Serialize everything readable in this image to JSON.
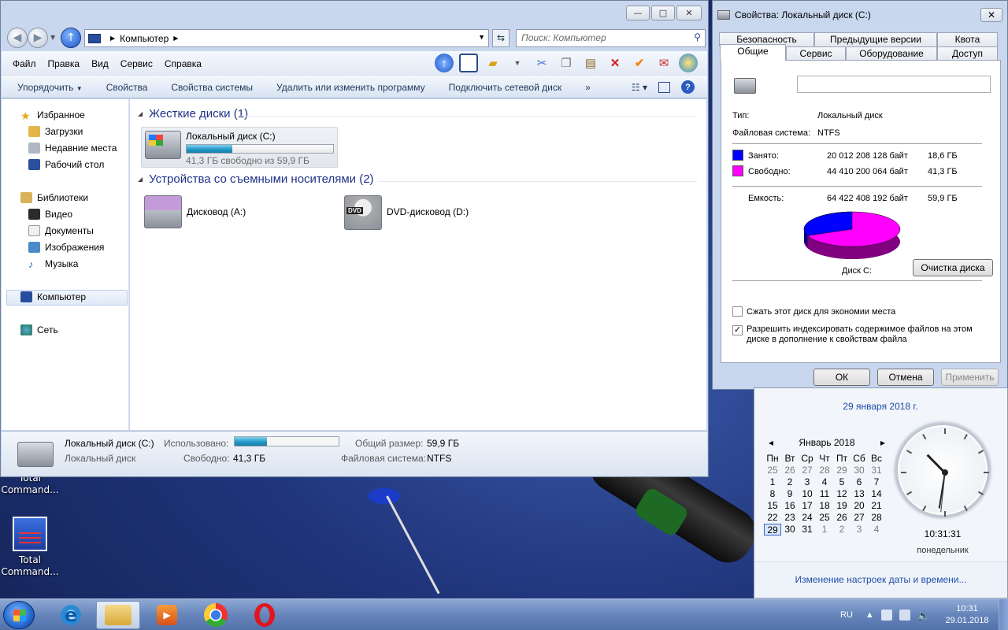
{
  "explorer": {
    "address": {
      "location": "Компьютер"
    },
    "search": {
      "placeholder": "Поиск: Компьютер"
    },
    "menu": [
      "Файл",
      "Правка",
      "Вид",
      "Сервис",
      "Справка"
    ],
    "toolbar_icons": [
      "up-folder-icon",
      "preview-pane-icon",
      "folder-icon",
      "cut-icon",
      "copy-icon",
      "paste-icon",
      "delete-icon",
      "check-icon",
      "mail-icon",
      "network-icon"
    ],
    "commands": [
      "Упорядочить",
      "Свойства",
      "Свойства системы",
      "Удалить или изменить программу",
      "Подключить сетевой диск"
    ],
    "more": "»",
    "nav": {
      "favorites": "Избранное",
      "downloads": "Загрузки",
      "recent": "Недавние места",
      "desktop": "Рабочий стол",
      "libraries": "Библиотеки",
      "video": "Видео",
      "documents": "Документы",
      "images": "Изображения",
      "music": "Музыка",
      "computer": "Компьютер",
      "network": "Сеть"
    },
    "groups": {
      "hard_disks": "Жесткие диски (1)",
      "removable": "Устройства со съемными носителями (2)"
    },
    "drives": {
      "c": {
        "name": "Локальный диск (C:)",
        "free_text": "41,3 ГБ свободно из 59,9 ГБ",
        "used_fraction": 0.31
      },
      "a": {
        "name": "Дисковод (A:)"
      },
      "d": {
        "name": "DVD-дисковод (D:)",
        "badge": "DVD"
      }
    },
    "status": {
      "name": "Локальный диск (C:)",
      "type": "Локальный диск",
      "used_label": "Использовано:",
      "free_label": "Свободно:",
      "free_value": "41,3 ГБ",
      "total_label": "Общий размер:",
      "total_value": "59,9 ГБ",
      "fs_label": "Файловая система:",
      "fs_value": "NTFS"
    }
  },
  "props": {
    "title": "Свойства: Локальный диск (C:)",
    "tabs_row1": [
      "Безопасность",
      "Предыдущие версии",
      "Квота"
    ],
    "tabs_row2": [
      "Общие",
      "Сервис",
      "Оборудование",
      "Доступ"
    ],
    "type_label": "Тип:",
    "type_value": "Локальный диск",
    "fs_label": "Файловая система:",
    "fs_value": "NTFS",
    "used_label": "Занято:",
    "used_bytes": "20 012 208 128 байт",
    "used_gb": "18,6 ГБ",
    "free_label": "Свободно:",
    "free_bytes": "44 410 200 064 байт",
    "free_gb": "41,3 ГБ",
    "cap_label": "Емкость:",
    "cap_bytes": "64 422 408 192 байт",
    "cap_gb": "59,9 ГБ",
    "disk_label": "Диск C:",
    "cleanup": "Очистка диска",
    "compress": "Сжать этот диск для экономии места",
    "index": "Разрешить индексировать содержимое файлов на этом диске в дополнение к свойствам файла",
    "index_checked": true,
    "compress_checked": false,
    "ok": "ОК",
    "cancel": "Отмена",
    "apply": "Применить",
    "colors": {
      "used": "#0000ff",
      "free": "#ff00ff"
    },
    "used_fraction": 0.311
  },
  "clock": {
    "date_link": "29 января 2018 г.",
    "month": "Январь 2018",
    "dow": [
      "Пн",
      "Вт",
      "Ср",
      "Чт",
      "Пт",
      "Сб",
      "Вс"
    ],
    "weeks": [
      [
        "25",
        "26",
        "27",
        "28",
        "29",
        "30",
        "31"
      ],
      [
        "1",
        "2",
        "3",
        "4",
        "5",
        "6",
        "7"
      ],
      [
        "8",
        "9",
        "10",
        "11",
        "12",
        "13",
        "14"
      ],
      [
        "15",
        "16",
        "17",
        "18",
        "19",
        "20",
        "21"
      ],
      [
        "22",
        "23",
        "24",
        "25",
        "26",
        "27",
        "28"
      ],
      [
        "29",
        "30",
        "31",
        "1",
        "2",
        "3",
        "4"
      ]
    ],
    "time": "10:31:31",
    "weekday": "понедельник",
    "settings_link": "Изменение настроек даты и времени..."
  },
  "desktop": {
    "icon1": "Total\nCommand...",
    "icon2_line1": "Total",
    "icon2_line2": "Command..."
  },
  "taskbar": {
    "lang": "RU",
    "time": "10:31",
    "date": "29.01.2018"
  }
}
